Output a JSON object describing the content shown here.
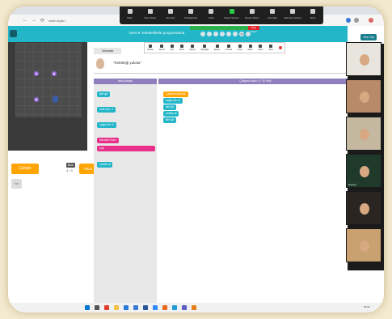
{
  "browser": {
    "url": "code.org/s/...",
    "navigation": [
      "←",
      "→",
      "⟳"
    ]
  },
  "zoom_toolbar": {
    "items": [
      {
        "label": "Mute",
        "icon": "microphone-icon",
        "color": "#d0d0d0"
      },
      {
        "label": "Stop Video",
        "icon": "video-camera-icon",
        "color": "#d0d0d0"
      },
      {
        "label": "Security",
        "icon": "shield-icon",
        "color": "#d0d0d0"
      },
      {
        "label": "Participants",
        "icon": "people-icon",
        "color": "#d0d0d0"
      },
      {
        "label": "Chat",
        "icon": "chat-icon",
        "color": "#d0d0d0"
      },
      {
        "label": "Share Screen",
        "icon": "share-screen-icon",
        "color": "#2cc84d"
      },
      {
        "label": "Pause Share",
        "icon": "pause-icon",
        "color": "#d0d0d0"
      },
      {
        "label": "Annotate",
        "icon": "pencil-icon",
        "color": "#d0d0d0"
      },
      {
        "label": "Remote Control",
        "icon": "remote-control-icon",
        "color": "#d0d0d0"
      },
      {
        "label": "More",
        "icon": "more-icon",
        "color": "#d0d0d0"
      }
    ],
    "stop_share_label": "Stop Share"
  },
  "app": {
    "course_title": "Ders 6: Kelebeklerle programlama",
    "lang_button": "Geç Yap",
    "level_dots": [
      "",
      "",
      "",
      "",
      "",
      "",
      "10",
      ""
    ],
    "header_color": "#22b6c8"
  },
  "annotate_toolbar": {
    "items": [
      {
        "label": "Mouse",
        "icon": "cursor-icon"
      },
      {
        "label": "Select",
        "icon": "select-icon"
      },
      {
        "label": "Text",
        "icon": "text-icon"
      },
      {
        "label": "Draw",
        "icon": "draw-icon"
      },
      {
        "label": "Stamp",
        "icon": "stamp-icon"
      },
      {
        "label": "Spotlight",
        "icon": "spotlight-icon"
      },
      {
        "label": "Eraser",
        "icon": "eraser-icon"
      },
      {
        "label": "Format",
        "icon": "format-icon"
      },
      {
        "label": "Undo",
        "icon": "undo-icon"
      },
      {
        "label": "Redo",
        "icon": "redo-icon"
      },
      {
        "label": "Clear",
        "icon": "clear-icon"
      },
      {
        "label": "Save",
        "icon": "save-icon"
      },
      {
        "label": "",
        "icon": "close-icon"
      }
    ]
  },
  "game": {
    "run_button": "Çalıştır",
    "step_button": "Adım",
    "reset_button": "Sıfır",
    "counter_label": "Blok",
    "counter_value": "4 / 3"
  },
  "instructions": {
    "tab_label": "Talimatlar",
    "text": "\"Kelebeği yakala\""
  },
  "workspace": {
    "toolbox_label": "Araç kutusu",
    "workspace_label": "Çalışma alanı: 4 / 10 blok",
    "toolbox_blocks": [
      {
        "label": "ileri git",
        "color": "blue"
      },
      {
        "label": "sola dön ↺",
        "color": "blue"
      },
      {
        "label": "sağa dön ↻",
        "color": "blue"
      },
      {
        "label": "tekrarla 5 kez",
        "color": "pink"
      },
      {
        "label": "yap",
        "color": "pink"
      },
      {
        "label": "nektar al",
        "color": "blue"
      }
    ],
    "program_blocks": [
      {
        "label": "Çalıştırıldığında",
        "color": "orange"
      },
      {
        "label": "sağa dön ↻",
        "color": "blue"
      },
      {
        "label": "ileri git",
        "color": "blue"
      },
      {
        "label": "nektar al",
        "color": "blue"
      },
      {
        "label": "ileri git",
        "color": "blue"
      }
    ]
  },
  "video_panel": {
    "participants": [
      "",
      "",
      "",
      "Zeynep Y",
      "",
      ""
    ]
  },
  "status_bar": {
    "url": "studio.code.org"
  },
  "taskbar": {
    "time": "15:02",
    "icons": [
      {
        "name": "start-icon",
        "color": "#0078d4"
      },
      {
        "name": "search-icon",
        "color": "#555555"
      },
      {
        "name": "chrome-icon",
        "color": "#e33b2e"
      },
      {
        "name": "explorer-icon",
        "color": "#f5c342"
      },
      {
        "name": "store-icon",
        "color": "#2a7bd8"
      },
      {
        "name": "mail-icon",
        "color": "#3b7bd8"
      },
      {
        "name": "word-icon",
        "color": "#2b579a"
      },
      {
        "name": "zoom-icon",
        "color": "#2d8cff"
      },
      {
        "name": "media-icon",
        "color": "#e86a1a"
      },
      {
        "name": "edge-icon",
        "color": "#1fa0d8"
      },
      {
        "name": "teams-icon",
        "color": "#5b5fc7"
      },
      {
        "name": "vlc-icon",
        "color": "#e87e1a"
      }
    ]
  }
}
